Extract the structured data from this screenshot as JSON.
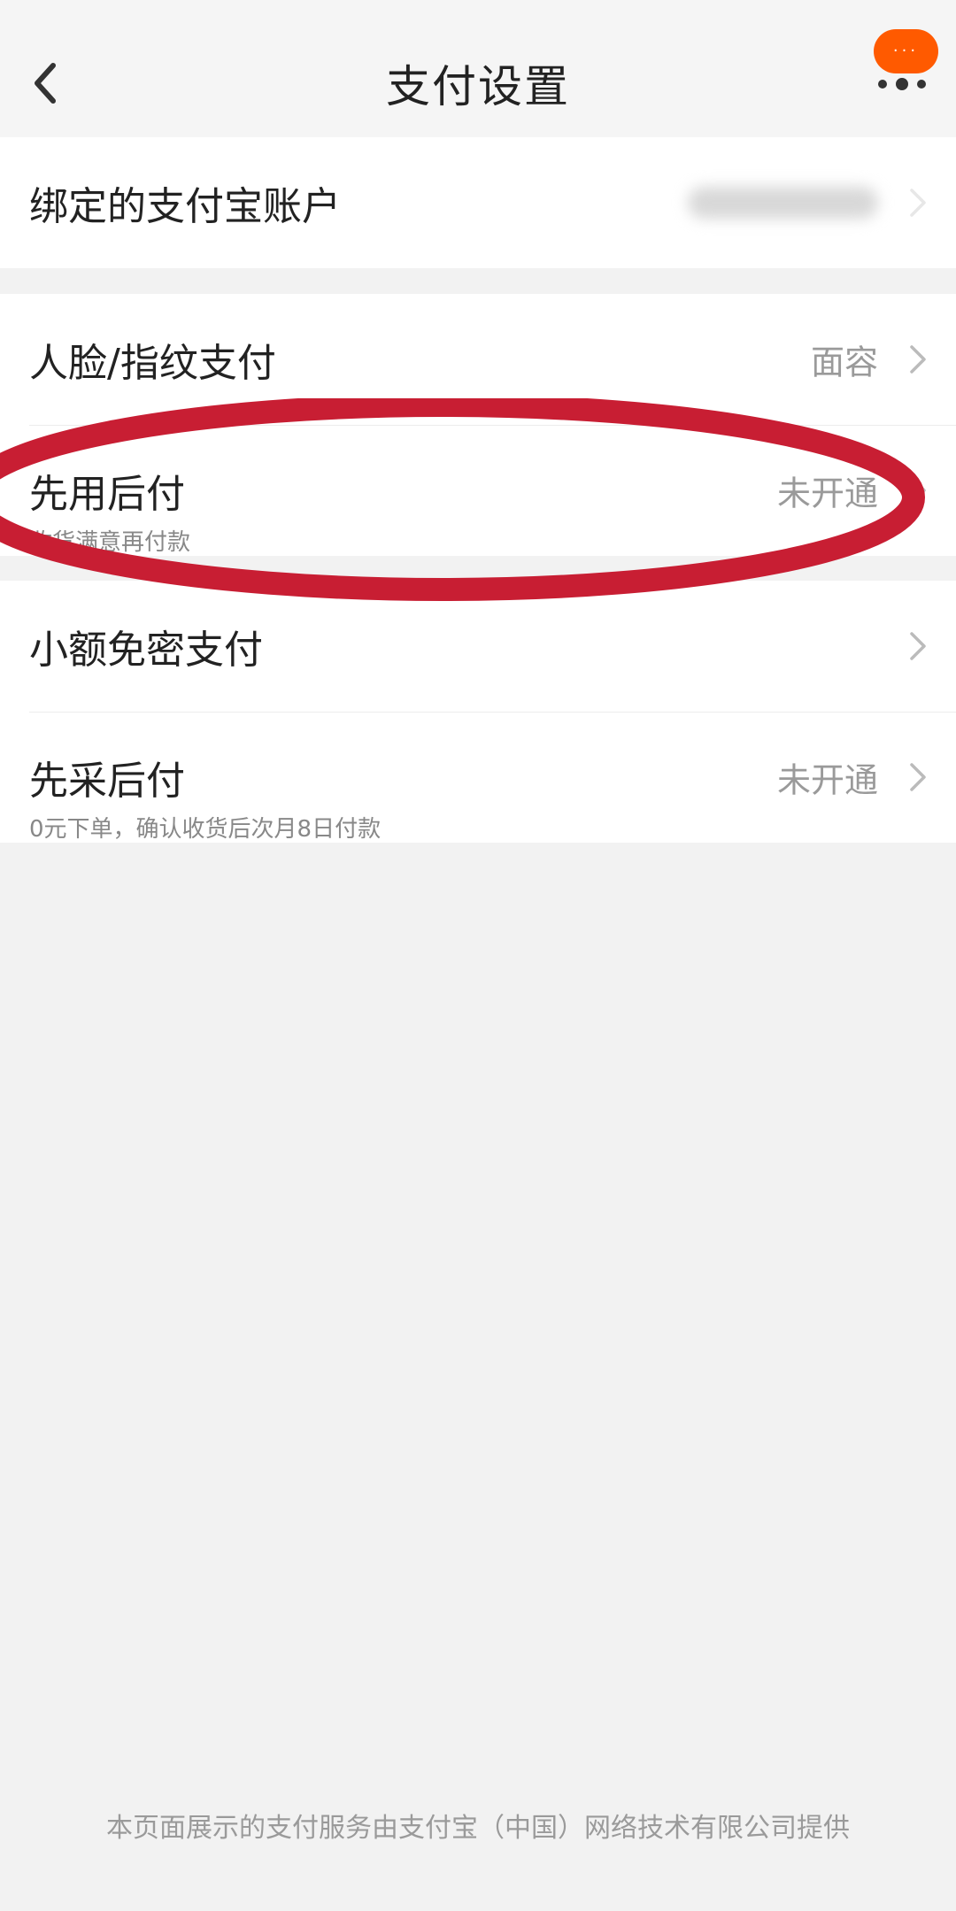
{
  "header": {
    "title": "支付设置",
    "back_icon": "chevron-left-icon",
    "message_badge": "···",
    "more_icon": "more-dots-icon"
  },
  "groups": [
    {
      "rows": [
        {
          "title": "绑定的支付宝账户",
          "value": "",
          "value_note": "blurred account"
        }
      ]
    },
    {
      "rows": [
        {
          "title": "人脸/指纹支付",
          "value": "面容"
        },
        {
          "title": "先用后付",
          "subtitle": "收货满意再付款",
          "value": "未开通"
        }
      ]
    },
    {
      "rows": [
        {
          "title": "小额免密支付",
          "value": ""
        },
        {
          "title": "先采后付",
          "subtitle": "0元下单，确认收货后次月8日付款",
          "value": "未开通"
        }
      ]
    }
  ],
  "footer": {
    "text": "本页面展示的支付服务由支付宝（中国）网络技术有限公司提供"
  },
  "colors": {
    "accent": "#ff5a00",
    "annotation": "#c81e33",
    "background": "#f2f2f2"
  }
}
